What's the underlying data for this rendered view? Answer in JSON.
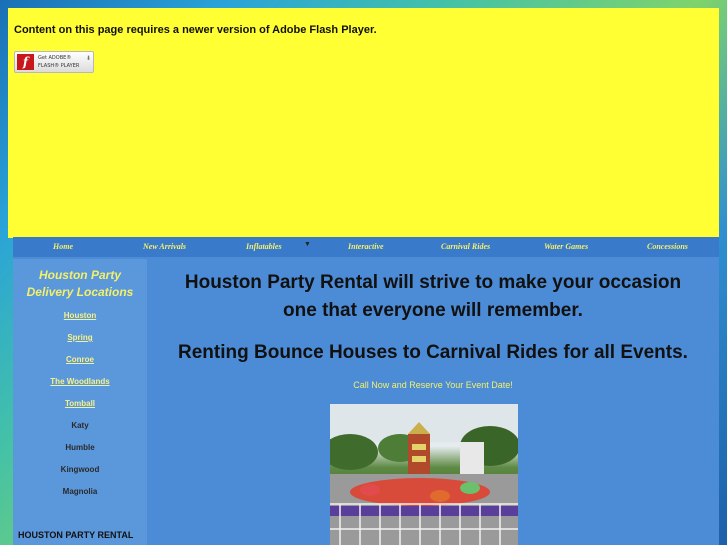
{
  "flash": {
    "message": "Content on this page requires a newer version of Adobe Flash Player.",
    "badge_line1": "Get ADOBE®",
    "badge_line2": "FLASH® PLAYER",
    "logo_letter": "f"
  },
  "nav": {
    "items": [
      "Home",
      "New Arrivals",
      "Inflatables",
      "Interactive",
      "Carnival Rides",
      "Water Games",
      "Concessions"
    ]
  },
  "sidebar": {
    "title_line1": "Houston Party",
    "title_line2": "Delivery Locations",
    "links": [
      "Houston",
      "Spring",
      "Conroe",
      "The Woodlands",
      "Tomball"
    ],
    "plain": [
      "Katy",
      "Humble",
      "Kingwood",
      "Magnolia"
    ],
    "footer": "HOUSTON PARTY RENTAL"
  },
  "main": {
    "headline_line1": "Houston Party Rental will strive to make your occasion",
    "headline_line2": "one that everyone will remember.",
    "subhead": "Renting Bounce Houses to Carnival Rides for all Events.",
    "call_text": "Call Now and Reserve Your Event Date!"
  },
  "colors": {
    "flash_bg": "#ffff33",
    "site_bg": "#4c8bd6",
    "nav_text": "#f3f06a"
  }
}
